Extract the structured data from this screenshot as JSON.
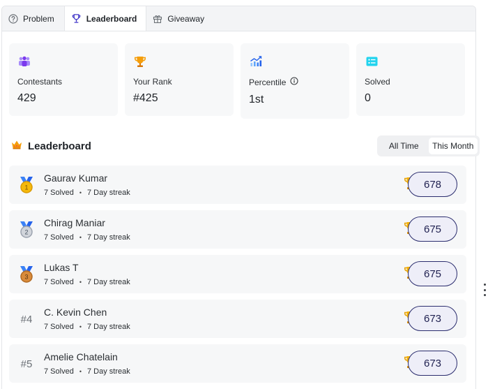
{
  "tabs": [
    {
      "label": "Problem",
      "icon": "help-circle-icon",
      "active": false
    },
    {
      "label": "Leaderboard",
      "icon": "trophy-icon",
      "active": true
    },
    {
      "label": "Giveaway",
      "icon": "gift-icon",
      "active": false
    }
  ],
  "stats": [
    {
      "label": "Contestants",
      "value": "429",
      "icon": "users-icon",
      "color": "#8b5cf6"
    },
    {
      "label": "Your Rank",
      "value": "#425",
      "icon": "trophy-icon",
      "color": "#f59e0b"
    },
    {
      "label": "Percentile",
      "value": "1st",
      "icon": "trend-chart-icon",
      "color": "#3b82f6"
    },
    {
      "label": "Solved",
      "value": "0",
      "icon": "list-icon",
      "color": "#06b6d4"
    }
  ],
  "leaderboard": {
    "title": "Leaderboard",
    "filters": {
      "all_time": "All Time",
      "this_month": "This Month",
      "selected": "This Month"
    },
    "entries": [
      {
        "rank": "1",
        "name": "Gaurav Kumar",
        "solved": "7 Solved",
        "streak": "7 Day streak",
        "score": "678",
        "medal": "gold"
      },
      {
        "rank": "2",
        "name": "Chirag Maniar",
        "solved": "7 Solved",
        "streak": "7 Day streak",
        "score": "675",
        "medal": "silver"
      },
      {
        "rank": "3",
        "name": "Lukas T",
        "solved": "7 Solved",
        "streak": "7 Day streak",
        "score": "675",
        "medal": "bronze"
      },
      {
        "rank": "#4",
        "name": "C. Kevin Chen",
        "solved": "7 Solved",
        "streak": "7 Day streak",
        "score": "673",
        "medal": ""
      },
      {
        "rank": "#5",
        "name": "Amelie Chatelain",
        "solved": "7 Solved",
        "streak": "7 Day streak",
        "score": "673",
        "medal": ""
      }
    ]
  },
  "separator": "•"
}
